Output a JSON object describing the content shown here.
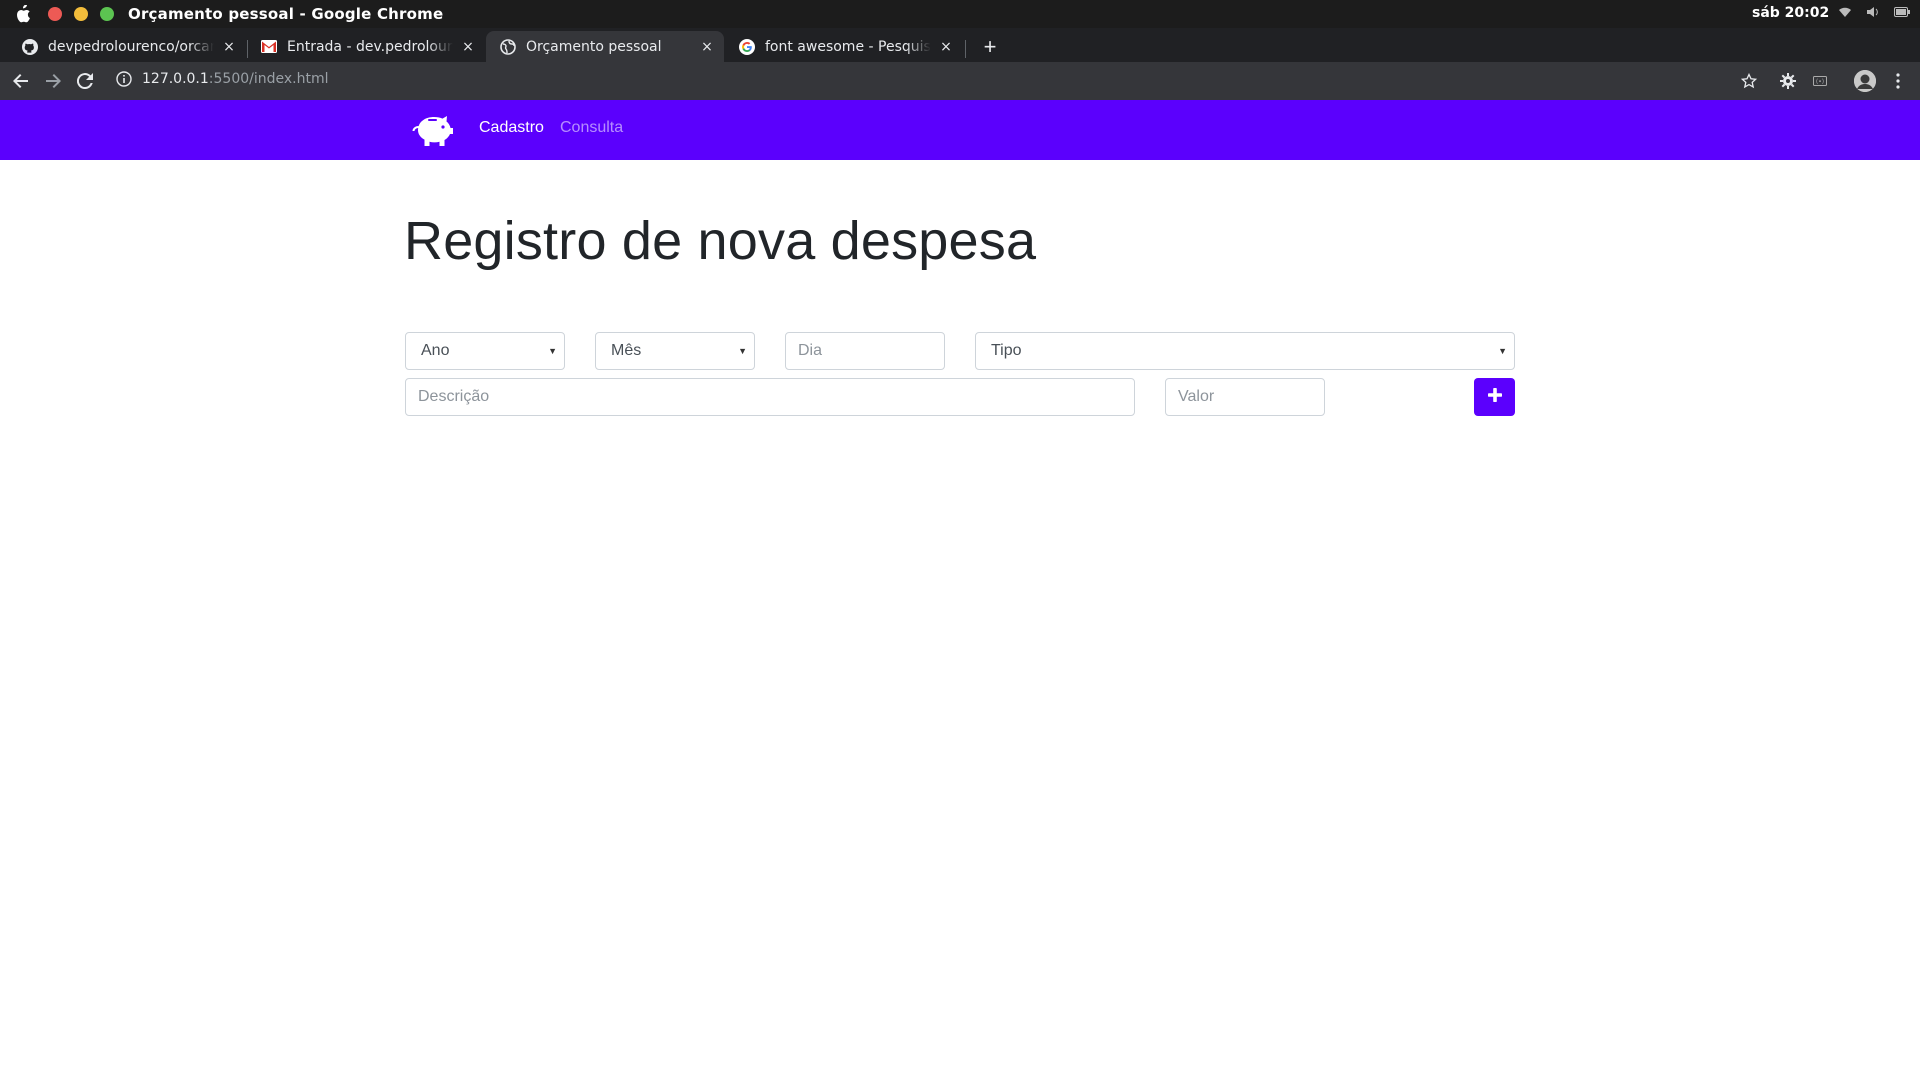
{
  "os": {
    "window_title": "Orçamento pessoal - Google Chrome",
    "clock": "sáb 20:02"
  },
  "browser": {
    "tabs": [
      {
        "label": "devpedrolourenco/orcamento",
        "icon": "github-icon",
        "active": false
      },
      {
        "label": "Entrada - dev.pedrolourenco",
        "icon": "gmail-icon",
        "active": false
      },
      {
        "label": "Orçamento pessoal",
        "icon": "globe-icon",
        "active": true
      },
      {
        "label": "font awesome - Pesquisa Google",
        "icon": "google-icon",
        "active": false
      }
    ],
    "new_tab_label": "+",
    "close_label": "×",
    "url_host": "127.0.0.1",
    "url_path": ":5500/index.html"
  },
  "app": {
    "brand_icon": "piggy-bank-icon",
    "accent_color": "#5b00fd",
    "nav": {
      "cadastro": "Cadastro",
      "consulta": "Consulta"
    },
    "heading": "Registro de nova despesa",
    "form": {
      "ano": "Ano",
      "mes": "Mês",
      "dia_placeholder": "Dia",
      "tipo": "Tipo",
      "descricao_placeholder": "Descrição",
      "valor_placeholder": "Valor",
      "add_icon": "plus-icon"
    }
  }
}
